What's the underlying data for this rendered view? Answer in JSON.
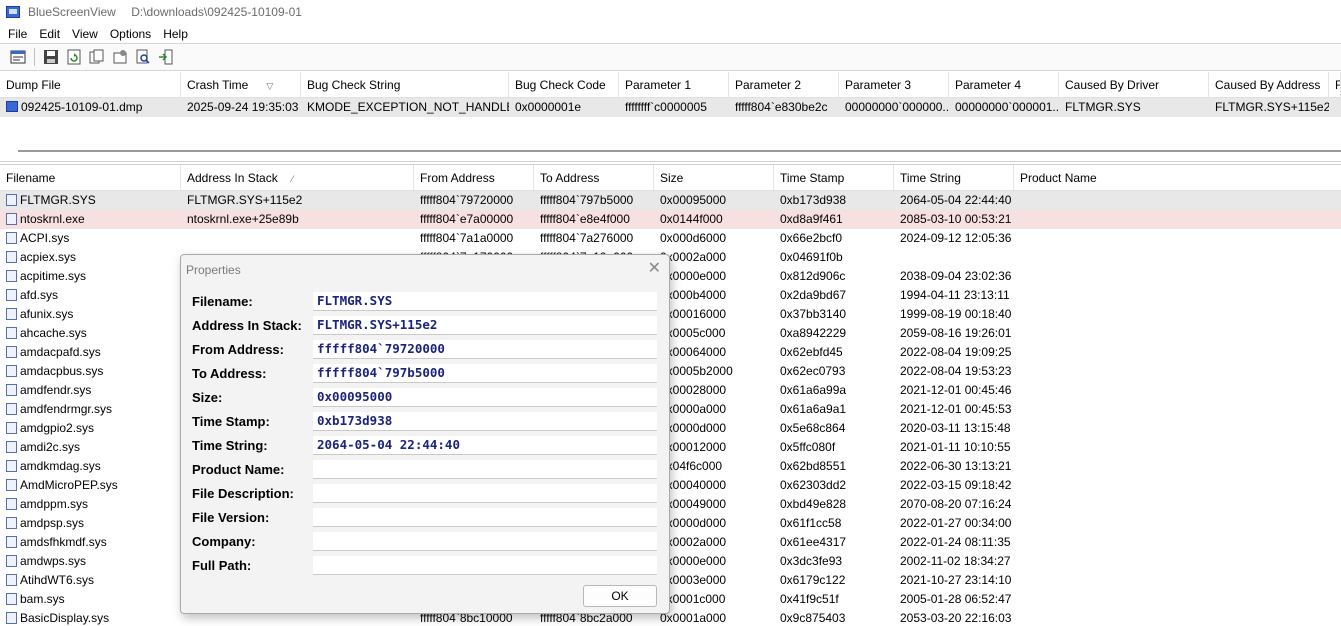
{
  "window": {
    "app_name": "BlueScreenView",
    "path": "D:\\downloads\\092425-10109-01"
  },
  "menu": [
    "File",
    "Edit",
    "View",
    "Options",
    "Help"
  ],
  "toolbar": {
    "icons": [
      "properties-icon",
      "save-icon",
      "refresh-icon",
      "copy-icon",
      "options-icon",
      "find-icon",
      "exit-icon"
    ]
  },
  "dumps": {
    "columns": [
      "Dump File",
      "Crash Time",
      "Bug Check String",
      "Bug Check Code",
      "Parameter 1",
      "Parameter 2",
      "Parameter 3",
      "Parameter 4",
      "Caused By Driver",
      "Caused By Address",
      "F"
    ],
    "rows": [
      [
        "092425-10109-01.dmp",
        "2025-09-24 19:35:03",
        "KMODE_EXCEPTION_NOT_HANDLED",
        "0x0000001e",
        "ffffffff`c0000005",
        "fffff804`e830be2c",
        "00000000`000000...",
        "00000000`000001...",
        "FLTMGR.SYS",
        "FLTMGR.SYS+115e2",
        ""
      ]
    ]
  },
  "drivers": {
    "columns": [
      "Filename",
      "Address In Stack",
      "From Address",
      "To Address",
      "Size",
      "Time Stamp",
      "Time String",
      "Product Name"
    ],
    "rows": [
      [
        "FLTMGR.SYS",
        "FLTMGR.SYS+115e2",
        "fffff804`79720000",
        "fffff804`797b5000",
        "0x00095000",
        "0xb173d938",
        "2064-05-04 22:44:40",
        ""
      ],
      [
        "ntoskrnl.exe",
        "ntoskrnl.exe+25e89b",
        "fffff804`e7a00000",
        "fffff804`e8e4f000",
        "0x0144f000",
        "0xd8a9f461",
        "2085-03-10 00:53:21",
        ""
      ],
      [
        "ACPI.sys",
        "",
        "fffff804`7a1a0000",
        "fffff804`7a276000",
        "0x000d6000",
        "0x66e2bcf0",
        "2024-09-12 12:05:36",
        ""
      ],
      [
        "acpiex.sys",
        "",
        "fffff804`7a170000",
        "fffff804`7a19a000",
        "0x0002a000",
        "0x04691f0b",
        "",
        ""
      ],
      [
        "acpitime.sys",
        "",
        "",
        "",
        "0x0000e000",
        "0x812d906c",
        "2038-09-04 23:02:36",
        ""
      ],
      [
        "afd.sys",
        "",
        "",
        "",
        "0x000b4000",
        "0x2da9bd67",
        "1994-04-11 23:13:11",
        ""
      ],
      [
        "afunix.sys",
        "",
        "",
        "",
        "0x00016000",
        "0x37bb3140",
        "1999-08-19 00:18:40",
        ""
      ],
      [
        "ahcache.sys",
        "",
        "",
        "",
        "0x0005c000",
        "0xa8942229",
        "2059-08-16 19:26:01",
        ""
      ],
      [
        "amdacpafd.sys",
        "",
        "",
        "",
        "0x00064000",
        "0x62ebfd45",
        "2022-08-04 19:09:25",
        ""
      ],
      [
        "amdacpbus.sys",
        "",
        "",
        "",
        "0x0005b2000",
        "0x62ec0793",
        "2022-08-04 19:53:23",
        ""
      ],
      [
        "amdfendr.sys",
        "",
        "",
        "",
        "0x00028000",
        "0x61a6a99a",
        "2021-12-01 00:45:46",
        ""
      ],
      [
        "amdfendrmgr.sys",
        "",
        "",
        "",
        "0x0000a000",
        "0x61a6a9a1",
        "2021-12-01 00:45:53",
        ""
      ],
      [
        "amdgpio2.sys",
        "",
        "",
        "",
        "0x0000d000",
        "0x5e68c864",
        "2020-03-11 13:15:48",
        ""
      ],
      [
        "amdi2c.sys",
        "",
        "",
        "",
        "0x00012000",
        "0x5ffc080f",
        "2021-01-11 10:10:55",
        ""
      ],
      [
        "amdkmdag.sys",
        "",
        "",
        "",
        "0x04f6c000",
        "0x62bd8551",
        "2022-06-30 13:13:21",
        ""
      ],
      [
        "AmdMicroPEP.sys",
        "",
        "",
        "",
        "0x00040000",
        "0x62303dd2",
        "2022-03-15 09:18:42",
        ""
      ],
      [
        "amdppm.sys",
        "",
        "",
        "",
        "0x00049000",
        "0xbd49e828",
        "2070-08-20 07:16:24",
        ""
      ],
      [
        "amdpsp.sys",
        "",
        "",
        "",
        "0x0000d000",
        "0x61f1cc58",
        "2022-01-27 00:34:00",
        ""
      ],
      [
        "amdsfhkmdf.sys",
        "",
        "",
        "",
        "0x0002a000",
        "0x61ee4317",
        "2022-01-24 08:11:35",
        ""
      ],
      [
        "amdwps.sys",
        "",
        "",
        "",
        "0x0000e000",
        "0x3dc3fe93",
        "2002-11-02 18:34:27",
        ""
      ],
      [
        "AtihdWT6.sys",
        "",
        "",
        "",
        "0x0003e000",
        "0x6179c122",
        "2021-10-27 23:14:10",
        ""
      ],
      [
        "bam.sys",
        "",
        "",
        "",
        "0x0001c000",
        "0x41f9c51f",
        "2005-01-28 06:52:47",
        ""
      ],
      [
        "BasicDisplay.sys",
        "",
        "fffff804`8bc10000",
        "fffff804`8bc2a000",
        "0x0001a000",
        "0x9c875403",
        "2053-03-20 22:16:03",
        ""
      ]
    ]
  },
  "dialog": {
    "title": "Properties",
    "fields": [
      {
        "label": "Filename:",
        "value": "FLTMGR.SYS"
      },
      {
        "label": "Address In Stack:",
        "value": "FLTMGR.SYS+115e2"
      },
      {
        "label": "From Address:",
        "value": "fffff804`79720000"
      },
      {
        "label": "To Address:",
        "value": "fffff804`797b5000"
      },
      {
        "label": "Size:",
        "value": "0x00095000"
      },
      {
        "label": "Time Stamp:",
        "value": "0xb173d938"
      },
      {
        "label": "Time String:",
        "value": "2064-05-04 22:44:40"
      },
      {
        "label": "Product Name:",
        "value": ""
      },
      {
        "label": "File Description:",
        "value": ""
      },
      {
        "label": "File Version:",
        "value": ""
      },
      {
        "label": "Company:",
        "value": ""
      },
      {
        "label": "Full Path:",
        "value": ""
      }
    ],
    "ok_label": "OK"
  }
}
